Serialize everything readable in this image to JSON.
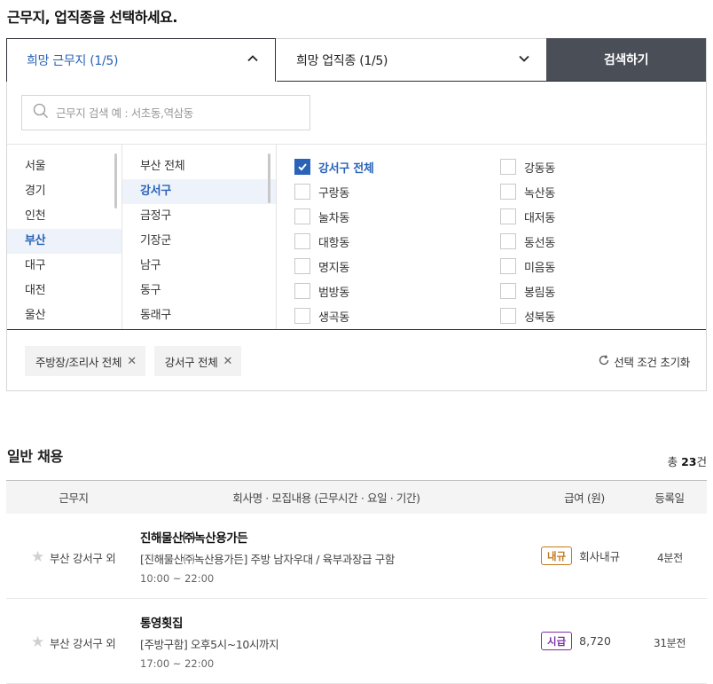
{
  "page_title": "근무지, 업직종을 선택하세요.",
  "tabs": {
    "area_label": "희망 근무지 (1/5)",
    "job_label": "희망 업직종 (1/5)",
    "search_button": "검색하기"
  },
  "area_search": {
    "placeholder": "근무지 검색 예 : 서초동,역삼동"
  },
  "regions": [
    "서울",
    "경기",
    "인천",
    "부산",
    "대구",
    "대전",
    "울산"
  ],
  "selected_region": "부산",
  "districts": [
    "부산 전체",
    "강서구",
    "금정구",
    "기장군",
    "남구",
    "동구",
    "동래구"
  ],
  "selected_district": "강서구",
  "neighborhoods_left": [
    {
      "label": "강서구 전체",
      "checked": true
    },
    {
      "label": "구랑동",
      "checked": false
    },
    {
      "label": "눌차동",
      "checked": false
    },
    {
      "label": "대항동",
      "checked": false
    },
    {
      "label": "명지동",
      "checked": false
    },
    {
      "label": "범방동",
      "checked": false
    },
    {
      "label": "생곡동",
      "checked": false
    }
  ],
  "neighborhoods_right": [
    {
      "label": "강동동",
      "checked": false
    },
    {
      "label": "녹산동",
      "checked": false
    },
    {
      "label": "대저동",
      "checked": false
    },
    {
      "label": "동선동",
      "checked": false
    },
    {
      "label": "미음동",
      "checked": false
    },
    {
      "label": "봉림동",
      "checked": false
    },
    {
      "label": "성북동",
      "checked": false
    }
  ],
  "chips": [
    "주방장/조리사 전체",
    "강서구 전체"
  ],
  "reset_label": "선택 조건 초기화",
  "listing": {
    "section_title": "일반 채용",
    "total_prefix": "총 ",
    "total_count": "23",
    "total_suffix": "건",
    "headers": {
      "area": "근무지",
      "company": "회사명 · 모집내용 (근무시간 · 요일 · 기간)",
      "pay": "급여 (원)",
      "posted": "등록일"
    },
    "rows": [
      {
        "area": "부산 강서구 외",
        "company": "진해물산㈜녹산용가든",
        "desc": "[진해물산㈜녹산용가든] 주방 남자우대 / 육부과장급 구함",
        "time": "10:00 ~ 22:00",
        "pay_type": "내규",
        "pay_value": "회사내규",
        "posted": "4분전"
      },
      {
        "area": "부산 강서구 외",
        "company": "통영횟집",
        "desc": "[주방구함] 오후5시~10시까지",
        "time": "17:00 ~ 22:00",
        "pay_type": "시급",
        "pay_value": "8,720",
        "posted": "31분전"
      }
    ]
  },
  "colors": {
    "accent": "#2962b6",
    "search_button_bg": "#4a4e56",
    "badge_internal": "#c47a1e",
    "badge_hourly": "#7b2fa8"
  }
}
